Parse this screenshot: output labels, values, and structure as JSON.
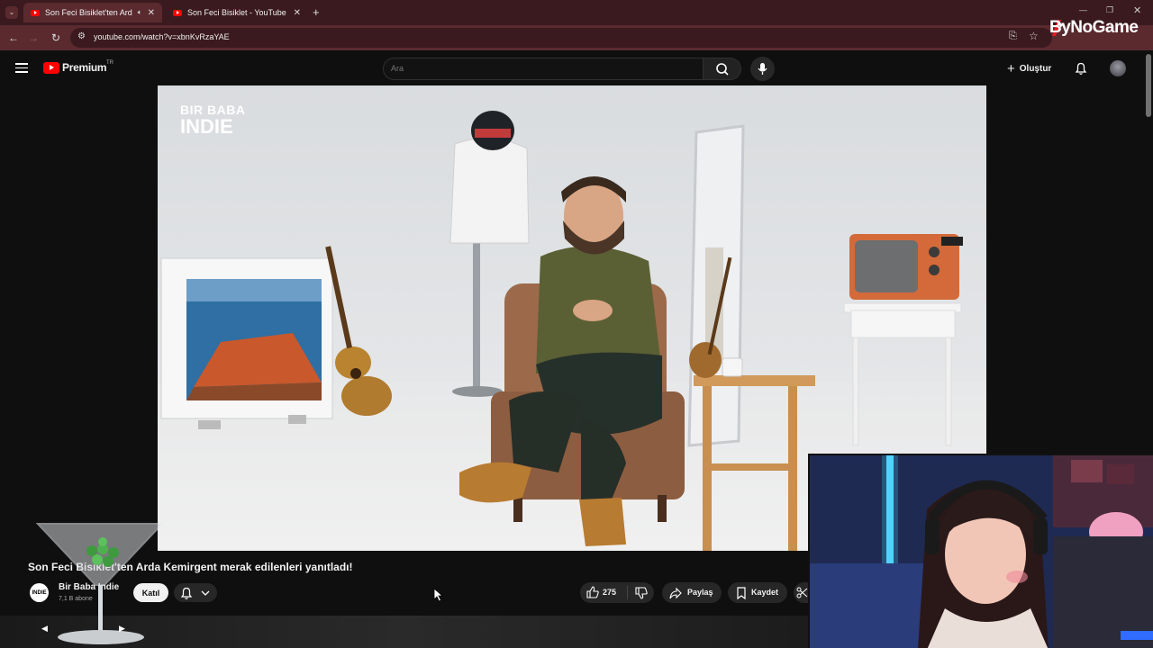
{
  "browser": {
    "tabs": [
      {
        "title": "Son Feci Bisiklet'ten Arda K",
        "active": true
      },
      {
        "title": "Son Feci Bisiklet - YouTube",
        "active": false
      }
    ],
    "new_tab": "+",
    "url": "youtube.com/watch?v=xbnKvRzaYAE",
    "overlay_brand": "ByNoGame"
  },
  "youtube": {
    "logo_text": "Premium",
    "logo_region": "TR",
    "search_placeholder": "Ara",
    "create_label": "Oluştur"
  },
  "video": {
    "channel_watermark_line1": "BIR BABA",
    "channel_watermark_line2": "INDIE",
    "title": "Son Feci Bisiklet'ten Arda Kemirgent merak edilenleri yanıtladı!",
    "channel_name": "Bir Baba Indie",
    "subscribers": "7,1 B abone",
    "join_label": "Katıl",
    "like_count": "275",
    "share_label": "Paylaş",
    "save_label": "Kaydet"
  },
  "colors": {
    "tab_bar": "#3a1a1e",
    "address_bar": "#5a2a2f",
    "youtube_red": "#ff0000",
    "page_bg": "#0f0f0f"
  }
}
